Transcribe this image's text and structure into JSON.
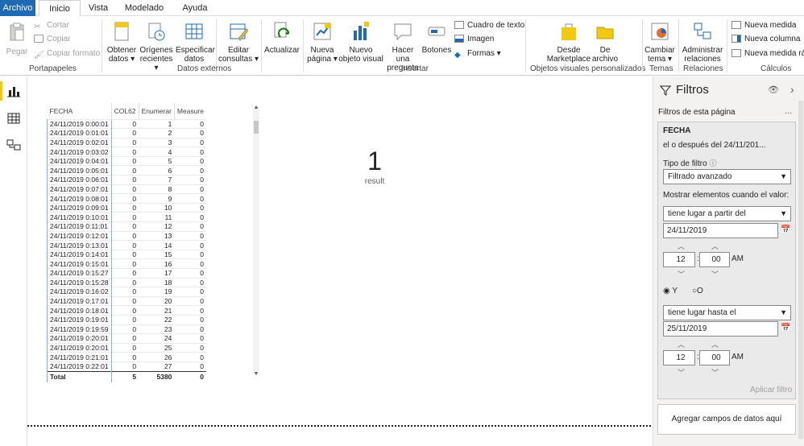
{
  "tabs": {
    "archivo": "Archivo",
    "inicio": "Inicio",
    "vista": "Vista",
    "modelado": "Modelado",
    "ayuda": "Ayuda"
  },
  "ribbon": {
    "pegar": "Pegar",
    "cortar": "Cortar",
    "copiar": "Copiar",
    "copiar_formato": "Copiar formato",
    "obtener": "Obtener",
    "obtener2": "datos ▾",
    "origenes": "Orígenes",
    "origenes2": "recientes ▾",
    "especificar": "Especificar",
    "especificar2": "datos",
    "editar": "Editar",
    "editar2": "consultas ▾",
    "actualizar": "Actualizar",
    "nueva_pagina": "Nueva",
    "nueva_pagina2": "página ▾",
    "nuevo_visual": "Nuevo",
    "nuevo_visual2": "objeto visual",
    "hacer": "Hacer una",
    "hacer2": "pregunta",
    "botones": "Botones",
    "cuadro": "Cuadro de texto",
    "imagen": "Imagen",
    "formas": "Formas ▾",
    "marketplace": "Desde",
    "marketplace2": "Marketplace",
    "archivo_vis": "De",
    "archivo_vis2": "archivo",
    "cambiar": "Cambiar",
    "cambiar2": "tema ▾",
    "administrar": "Administrar",
    "administrar2": "relaciones",
    "nueva_medida": "Nueva medida",
    "nueva_columna": "Nueva columna",
    "nueva_medida_rapida": "Nueva medida ráp",
    "groups": {
      "portapapeles": "Portapapeles",
      "datos_externos": "Datos externos",
      "insertar": "Insertar",
      "objetos": "Objetos visuales personalizados",
      "temas": "Temas",
      "relaciones": "Relaciones",
      "calculos": "Cálculos"
    }
  },
  "table": {
    "headers": [
      "FECHA",
      "COL62",
      "Enumerar",
      "Measure"
    ],
    "rows": [
      [
        "24/11/2019 0:00:01",
        "0",
        "1",
        "0"
      ],
      [
        "24/11/2019 0:01:01",
        "0",
        "2",
        "0"
      ],
      [
        "24/11/2019 0:02:01",
        "0",
        "3",
        "0"
      ],
      [
        "24/11/2019 0:03:02",
        "0",
        "4",
        "0"
      ],
      [
        "24/11/2019 0:04:01",
        "0",
        "5",
        "0"
      ],
      [
        "24/11/2019 0:05:01",
        "0",
        "6",
        "0"
      ],
      [
        "24/11/2019 0:06:01",
        "0",
        "7",
        "0"
      ],
      [
        "24/11/2019 0:07:01",
        "0",
        "8",
        "0"
      ],
      [
        "24/11/2019 0:08:01",
        "0",
        "9",
        "0"
      ],
      [
        "24/11/2019 0:09:01",
        "0",
        "10",
        "0"
      ],
      [
        "24/11/2019 0:10:01",
        "0",
        "11",
        "0"
      ],
      [
        "24/11/2019 0:11:01",
        "0",
        "12",
        "0"
      ],
      [
        "24/11/2019 0:12:01",
        "0",
        "13",
        "0"
      ],
      [
        "24/11/2019 0:13:01",
        "0",
        "14",
        "0"
      ],
      [
        "24/11/2019 0:14:01",
        "0",
        "15",
        "0"
      ],
      [
        "24/11/2019 0:15:01",
        "0",
        "16",
        "0"
      ],
      [
        "24/11/2019 0:15:27",
        "0",
        "17",
        "0"
      ],
      [
        "24/11/2019 0:15:28",
        "0",
        "18",
        "0"
      ],
      [
        "24/11/2019 0:16:02",
        "0",
        "19",
        "0"
      ],
      [
        "24/11/2019 0:17:01",
        "0",
        "20",
        "0"
      ],
      [
        "24/11/2019 0:18:01",
        "0",
        "21",
        "0"
      ],
      [
        "24/11/2019 0:19:01",
        "0",
        "22",
        "0"
      ],
      [
        "24/11/2019 0:19:59",
        "0",
        "23",
        "0"
      ],
      [
        "24/11/2019 0:20:01",
        "0",
        "24",
        "0"
      ],
      [
        "24/11/2019 0:20:01",
        "0",
        "25",
        "0"
      ],
      [
        "24/11/2019 0:21:01",
        "0",
        "26",
        "0"
      ],
      [
        "24/11/2019 0:22:01",
        "0",
        "27",
        "0"
      ]
    ],
    "total": [
      "Total",
      "5",
      "5380",
      "0"
    ]
  },
  "card": {
    "value": "1",
    "label": "result"
  },
  "filters": {
    "title": "Filtros",
    "page_filters": "Filtros de esta página",
    "more": "...",
    "field": "FECHA",
    "summary": "el o después del 24/11/201...",
    "tipo_label": "Tipo de filtro",
    "tipo_value": "Filtrado avanzado",
    "mostrar": "Mostrar elementos cuando el valor:",
    "cond1": "tiene lugar a partir del",
    "date1": "24/11/2019",
    "hour1": "12",
    "min1": "00",
    "ampm1": "AM",
    "and": "Y",
    "or": "O",
    "cond2": "tiene lugar hasta el",
    "date2": "25/11/2019",
    "hour2": "12",
    "min2": "00",
    "ampm2": "AM",
    "apply": "Aplicar filtro",
    "add_fields": "Agregar campos de datos aquí"
  },
  "colors": {
    "accent": "#1f6ab3",
    "rail_active": "#f2c811"
  }
}
